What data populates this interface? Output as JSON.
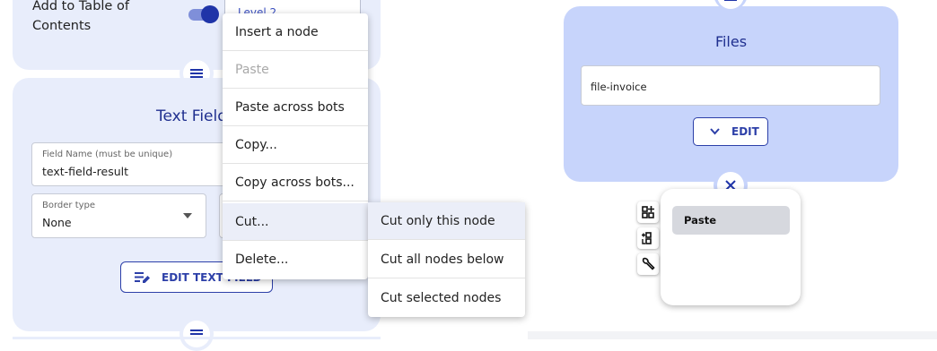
{
  "left_panel": {
    "toc": {
      "label": "Add to Table of Contents",
      "toggle_on": true,
      "level_value": "Level 2"
    },
    "text_field_section": {
      "title": "Text Field",
      "field_name": {
        "label": "Field Name (must be unique)",
        "value": "text-field-result"
      },
      "border_type": {
        "label": "Border type",
        "value": "None"
      },
      "edit_button_label": "EDIT TEXT FIELD"
    }
  },
  "context_menu": {
    "items": [
      {
        "label": "Insert a node",
        "disabled": false
      },
      {
        "label": "Paste",
        "disabled": true
      },
      {
        "label": "Paste across bots",
        "disabled": false
      },
      {
        "label": "Copy...",
        "disabled": false
      },
      {
        "label": "Copy across bots...",
        "disabled": false
      },
      {
        "label": "Cut...",
        "disabled": false,
        "active": true
      },
      {
        "label": "Delete...",
        "disabled": false
      }
    ],
    "submenu": {
      "items": [
        {
          "label": "Cut only this node",
          "active": true
        },
        {
          "label": "Cut all nodes below"
        },
        {
          "label": "Cut selected nodes"
        }
      ]
    }
  },
  "right_panel": {
    "files_card": {
      "title": "Files",
      "input_value": "file-invoice",
      "edit_button_label": "EDIT"
    },
    "side_tools": [
      "add-node-icon",
      "add-branch-icon",
      "wrench-icon"
    ],
    "paste_panel": {
      "button_label": "Paste"
    }
  },
  "colors": {
    "card_light": "#e8edfb",
    "card_blue": "#c7d4fb",
    "accent": "#2c3fa8",
    "title": "#1f2f8f"
  }
}
